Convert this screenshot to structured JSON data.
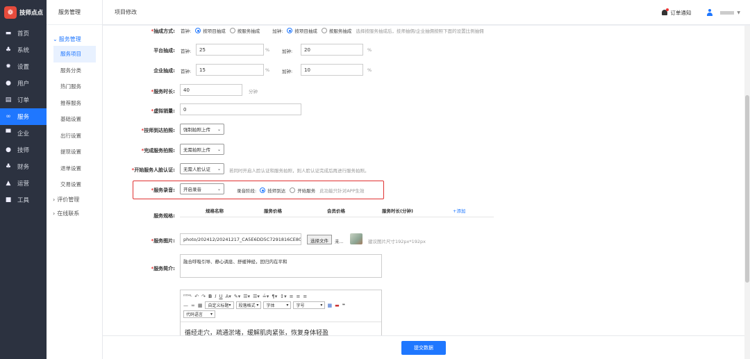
{
  "brand": {
    "name": "技师点点",
    "logo_char": "❁"
  },
  "sidebar": {
    "items": [
      {
        "label": "首页",
        "icon": "monitor-icon"
      },
      {
        "label": "系统",
        "icon": "sitemap-icon"
      },
      {
        "label": "设置",
        "icon": "gear-icon"
      },
      {
        "label": "用户",
        "icon": "user-icon"
      },
      {
        "label": "订单",
        "icon": "clipboard-icon"
      },
      {
        "label": "服务",
        "icon": "link-icon"
      },
      {
        "label": "企业",
        "icon": "building-icon"
      },
      {
        "label": "技师",
        "icon": "user-icon"
      },
      {
        "label": "财务",
        "icon": "sitemap-icon"
      },
      {
        "label": "运营",
        "icon": "chart-icon"
      },
      {
        "label": "工具",
        "icon": "toolbox-icon"
      }
    ],
    "active_index": 5
  },
  "secondary": {
    "title": "服务管理",
    "group_open": "服务管理",
    "items": [
      "服务项目",
      "服务分类",
      "热门服务",
      "推荐服务",
      "基础设置",
      "出行设置",
      "提现设置",
      "退单设置",
      "交易设置"
    ],
    "group_eval": "评价管理",
    "group_contact": "在线联系"
  },
  "topbar": {
    "breadcrumb": "项目修改",
    "notice": "订单通知"
  },
  "form": {
    "extract": {
      "label": "抽成方式:",
      "first": "首钟:",
      "opt1": "按项目抽成",
      "opt2": "按服务抽成",
      "add": "加钟:",
      "hint": "选择按服务抽成后，技师抽佣/企业抽佣按照下面的设置比例抽佣"
    },
    "platform": {
      "label": "平台抽成:",
      "first": "首钟:",
      "first_val": "25",
      "pct": "%",
      "add": "加钟:",
      "add_val": "20"
    },
    "company": {
      "label": "企业抽成:",
      "first": "首钟:",
      "first_val": "15",
      "pct": "%",
      "add": "加钟:",
      "add_val": "10"
    },
    "duration": {
      "label": "服务时长:",
      "value": "40",
      "unit": "分钟"
    },
    "virtual_sales": {
      "label": "虚拟销量:",
      "value": "0"
    },
    "arrive_photo": {
      "label": "技师到达拍照:",
      "value": "强制拍照上传"
    },
    "finish_photo": {
      "label": "完成服务拍照:",
      "value": "无需拍照上传"
    },
    "start_verify": {
      "label": "开始服务人脸认证:",
      "value": "无需人脸认证",
      "hint": "若同时开启人脸认证和服务拍照，则人脸认证完成后再进行服务拍照。"
    },
    "recording": {
      "label": "服务录音:",
      "value": "开启录音",
      "stage_label": "录音阶段:",
      "opt1": "技师到达",
      "opt2": "开始服务",
      "hint": "此功能只针对APP生效"
    },
    "spec": {
      "label": "服务规格:",
      "cols": [
        "规格名称",
        "服务价格",
        "会员价格",
        "服务时长(分钟)"
      ],
      "add": "+添加"
    },
    "image": {
      "label": "服务图片:",
      "path": "photo/202412/20241217_CA5E6DD5C7291816CE809",
      "btn": "选择文件",
      "btn_after": "未...",
      "hint": "建议图片尺寸192px*192px"
    },
    "intro": {
      "label": "服务简介:",
      "value": "融合呼吸引导、静心调息、舒缓神经，回归内在平和"
    },
    "editor": {
      "sel1": "自定义标题",
      "sel2": "段落格式",
      "sel3": "字体",
      "sel4": "字号",
      "sel5": "代码语言",
      "content": "循经走穴，疏通淤堵，缓解肌肉紧张，恢复身体轻盈"
    }
  },
  "footer": {
    "submit": "提交数据"
  }
}
